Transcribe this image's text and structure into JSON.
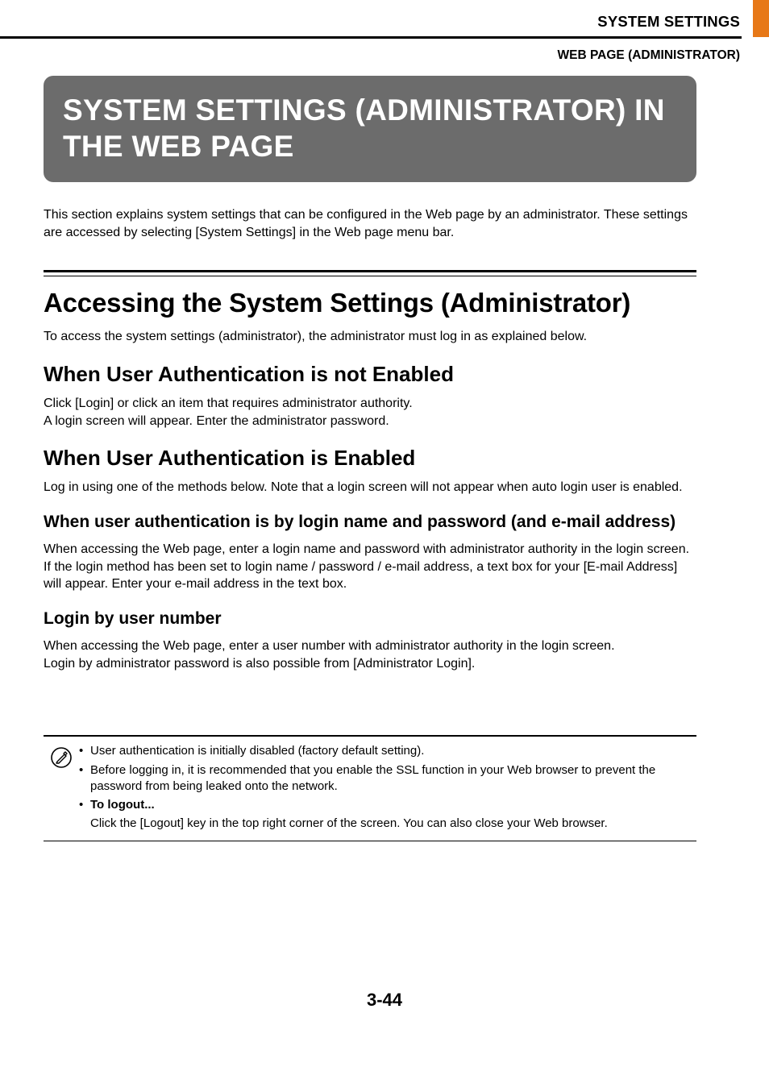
{
  "header": {
    "chapter": "SYSTEM SETTINGS",
    "subsection": "WEB PAGE (ADMINISTRATOR)"
  },
  "title": "SYSTEM SETTINGS (ADMINISTRATOR) IN THE WEB PAGE",
  "intro": "This section explains system settings that can be configured in the Web page by an administrator. These settings are accessed by selecting [System Settings] in the Web page menu bar.",
  "h2": "Accessing the System Settings (Administrator)",
  "h2_body": "To access the system settings (administrator), the administrator must log in as explained below.",
  "sec1": {
    "heading": "When User Authentication is not Enabled",
    "body": "Click [Login] or click an item that requires administrator authority.\nA login screen will appear. Enter the administrator password."
  },
  "sec2": {
    "heading": "When User Authentication is Enabled",
    "body": "Log in using one of the methods below. Note that a login screen will not appear when auto login user is enabled.",
    "sub1": {
      "heading": "When user authentication is by login name and password (and e-mail address)",
      "body": "When accessing the Web page, enter a login name and password with administrator authority in the login screen. If the login method has been set to login name / password / e-mail address, a text box for your [E-mail Address] will appear. Enter your e-mail address in the text box."
    },
    "sub2": {
      "heading": "Login by user number",
      "body": "When accessing the Web page, enter a user number with administrator authority in the login screen.\nLogin by administrator password is also possible from [Administrator Login]."
    }
  },
  "notes": {
    "bullet": "•",
    "item1": "User authentication is initially disabled (factory default setting).",
    "item2": "Before logging in, it is recommended that you enable the SSL function in your Web browser to prevent the password from being leaked onto the network.",
    "item3_label": "To logout...",
    "item3_body": "Click the [Logout] key in the top right corner of the screen. You can also close your Web browser."
  },
  "page_number": "3-44"
}
